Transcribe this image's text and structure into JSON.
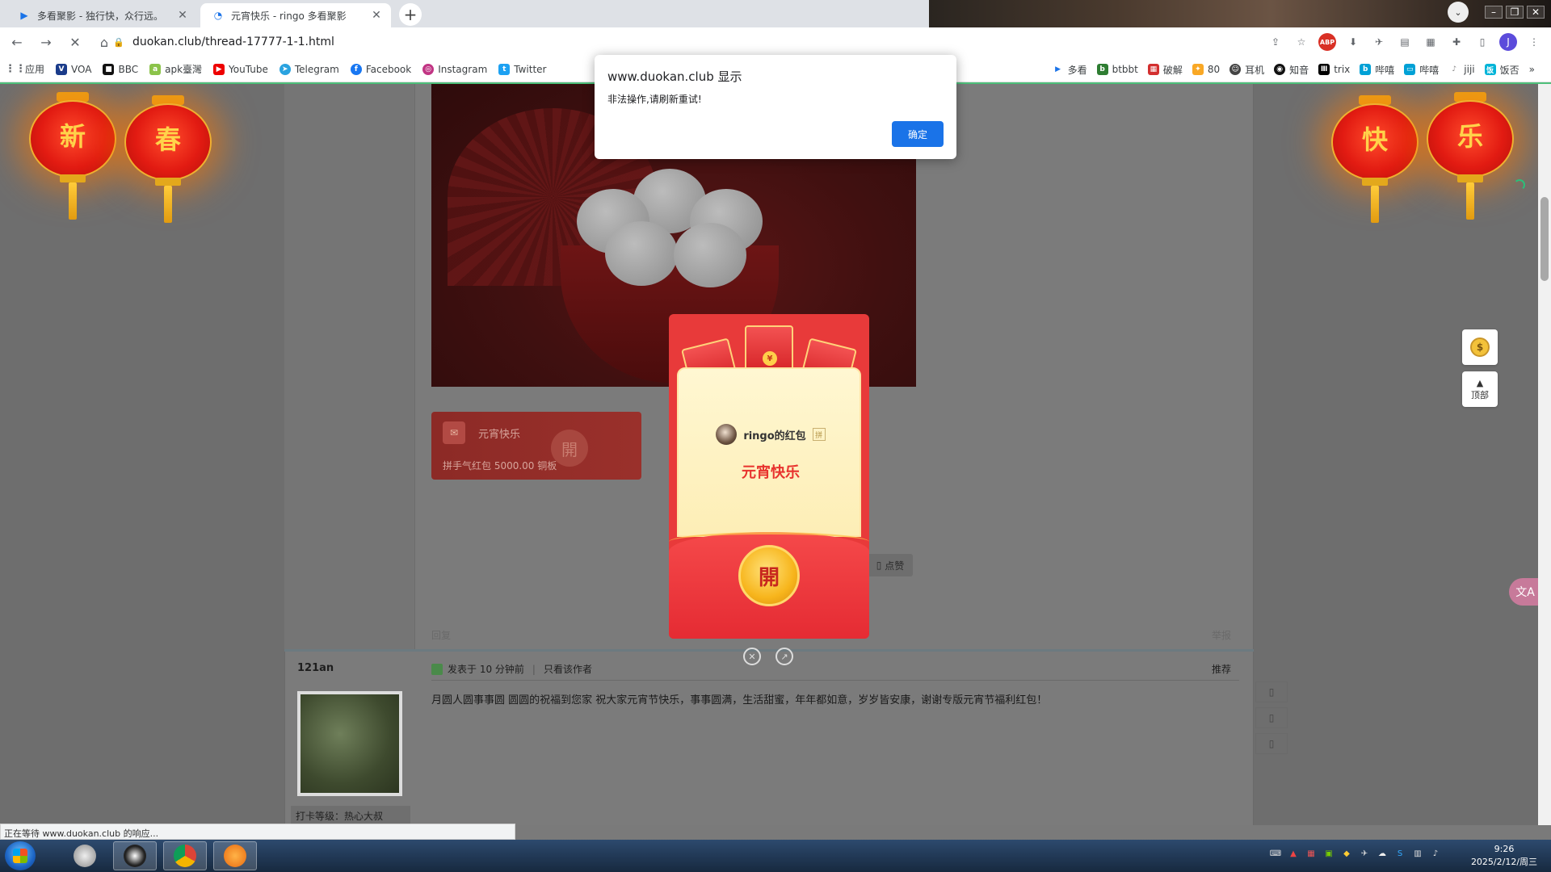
{
  "browser": {
    "tabs": [
      {
        "title": "多看聚影 - 独行快，众行远。",
        "active": false
      },
      {
        "title": "元宵快乐 - ringo 多看聚影",
        "active": true
      }
    ],
    "url": "duokan.club/thread-17777-1-1.html",
    "profile_initial": "J",
    "abp_label": "ABP"
  },
  "bookmarks": {
    "left": [
      "应用",
      "VOA",
      "BBC",
      "apk臺灣",
      "YouTube",
      "Telegram",
      "Facebook",
      "Instagram",
      "Twitter"
    ],
    "right": [
      "多看",
      "btbbt",
      "破解",
      "80",
      "耳机",
      "知音",
      "trix",
      "哔嘻",
      "哔嘻",
      "jiji",
      "饭否"
    ],
    "more": "»"
  },
  "alert": {
    "title": "www.duokan.club 显示",
    "message": "非法操作,请刷新重试!",
    "ok_label": "确定"
  },
  "lanterns": {
    "left": [
      "新",
      "春"
    ],
    "right": [
      "快",
      "乐"
    ]
  },
  "post1": {
    "redpack_title": "元宵快乐",
    "redpack_desc": "拼手气红包 5000.00 铜板",
    "redpack_coin": "開",
    "like_label": "点赞",
    "reply_label": "回复",
    "report_label": "举报"
  },
  "envelope": {
    "sender": "ringo的红包",
    "badge": "拼",
    "greeting": "元宵快乐",
    "open_label": "開",
    "yuan": "¥"
  },
  "post2": {
    "author": "121an",
    "meta": "发表于 10 分钟前",
    "only_author": "只看该作者",
    "recommend": "推荐",
    "body": "月圆人圆事事圆 圆圆的祝福到您家 祝大家元宵节快乐，事事圆满，生活甜蜜，年年都如意，岁岁皆安康，谢谢专版元宵节福利红包！",
    "rank": "打卡等级：热心大叔"
  },
  "float": {
    "coin": "$",
    "top_label": "顶部"
  },
  "status": "正在等待 www.duokan.club 的响应...",
  "clock": {
    "time": "9:26",
    "date": "2025/2/12/周三"
  }
}
